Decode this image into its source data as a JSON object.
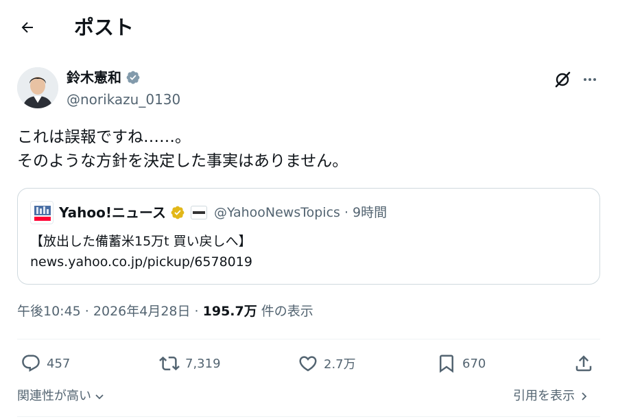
{
  "header": {
    "title": "ポスト",
    "back_icon": "arrow-left-icon"
  },
  "author": {
    "display_name": "鈴木憲和",
    "handle": "@norikazu_0130",
    "verified_badge": "gray-verified-icon",
    "badge_color": "#829aab"
  },
  "post": {
    "text": "これは誤報ですね……。\nそのような方針を決定した事実はありません。"
  },
  "quote": {
    "name": "Yahoo!ニュース",
    "verified_badge": "gold-verified-icon",
    "badge_color": "#e2b719",
    "affiliate_badge": "affiliate-logo-icon",
    "handle": "@YahooNewsTopics",
    "separator": "·",
    "time": "9時間",
    "body": "【放出した備蓄米15万t 買い戻しへ】\nnews.yahoo.co.jp/pickup/6578019"
  },
  "meta": {
    "time": "午後10:45",
    "sep1": " · ",
    "date": "2026年4月28日",
    "sep2": " · ",
    "views": "195.7万",
    "views_label": " 件の表示"
  },
  "actions": {
    "reply_count": "457",
    "repost_count": "7,319",
    "like_count": "2.7万",
    "bookmark_count": "670"
  },
  "footer": {
    "related": "関連性が高い",
    "view_quotes": "引用を表示"
  },
  "colors": {
    "text": "#0f1419",
    "secondary": "#536471",
    "border": "#cfd9de"
  }
}
